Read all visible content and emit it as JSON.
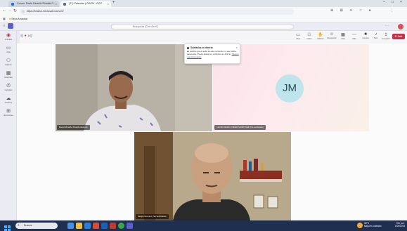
{
  "browser": {
    "tabs": [
      {
        "label": "Correo: David Ricardo Rivalde R",
        "active": false,
        "color": "#1a73e8"
      },
      {
        "label": "(17) Calendar | ODON - CIFC",
        "active": true,
        "color": "#6264a7"
      }
    ],
    "url": "https://teams.microsoft.com/v2/",
    "bookmark": "Sena Arrastrar"
  },
  "teams": {
    "search_placeholder": "Búsqueda (Ctrl+Alt+E)",
    "timer": "1:02",
    "toolbar": [
      {
        "icon": "chat-icon",
        "label": "Chat"
      },
      {
        "icon": "people-icon",
        "label": "Users"
      },
      {
        "icon": "raise-hand-icon",
        "label": "Mostrar"
      },
      {
        "icon": "react-icon",
        "label": "Reaccionar"
      },
      {
        "icon": "view-icon",
        "label": "Vista"
      },
      {
        "icon": "more-icon",
        "label": "Más"
      },
      {
        "icon": "camera-icon",
        "label": "Cámara"
      },
      {
        "icon": "mic-icon",
        "label": "Micr."
      },
      {
        "icon": "share-icon",
        "label": "Compartir"
      }
    ],
    "leave_label": "Salir",
    "rail": [
      {
        "icon": "activity-icon",
        "label": "Actividad"
      },
      {
        "icon": "chat-icon",
        "label": "Chat"
      },
      {
        "icon": "teams-icon",
        "label": "Equipos"
      },
      {
        "icon": "calendar-icon",
        "label": "Calendario"
      },
      {
        "icon": "calls-icon",
        "label": "Llamadas"
      },
      {
        "icon": "files-icon",
        "label": "OneDrive"
      },
      {
        "icon": "apps-icon",
        "label": "Aplicaciones"
      }
    ]
  },
  "participants": [
    {
      "name": "David Ricardo Rivalde Escudo"
    },
    {
      "name": "LAURA MARIA VIEIRA MARTINEZ (No verificado)",
      "initials": "JM"
    },
    {
      "name": "Sergio Romero (No verificado)"
    }
  ],
  "toast": {
    "title": "Subtítulos en directo",
    "body": "Es posible que el audio de este contenido no sea visible para todos. Puede activar los subtítulos en directo.",
    "link": "Obtener más información"
  },
  "taskbar": {
    "search_placeholder": "Buscar",
    "weather": "30°C",
    "weather_desc": "Mayorm. soleado",
    "time": "7:51 p.m.",
    "date": "1/05/2024"
  }
}
